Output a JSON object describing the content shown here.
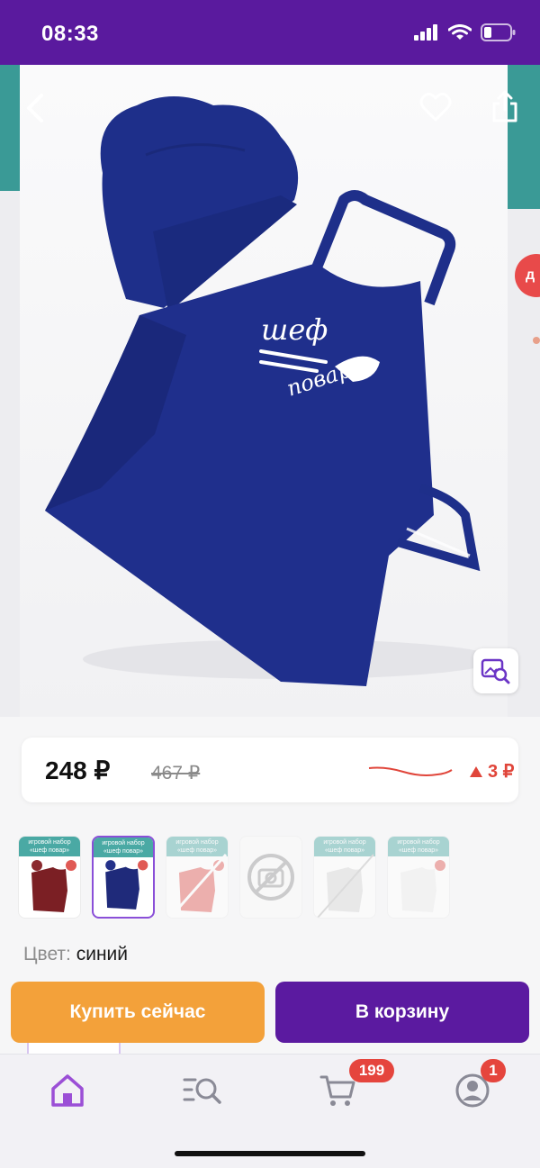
{
  "status_bar": {
    "time": "08:33"
  },
  "hero": {
    "back_icon": "chevron-left-icon",
    "favorite_icon": "heart-icon",
    "share_icon": "share-icon",
    "image_search_icon": "image-search-icon",
    "apron_logo_line1": "шеф",
    "apron_logo_line2": "повар",
    "peek_badge": "д"
  },
  "price": {
    "current": "248 ₽",
    "old": "467 ₽",
    "delta": "3 ₽",
    "delta_direction": "up",
    "trend_color": "#e0453a"
  },
  "thumbnails": [
    {
      "title": "игровой набор «шеф повар»",
      "apron_color": "#7b1f24",
      "selected": false,
      "faded": false
    },
    {
      "title": "игровой набор «шеф повар»",
      "apron_color": "#1f2a7a",
      "selected": true,
      "faded": false
    },
    {
      "title": "игровой набор «шеф повар»",
      "apron_color": "#e05a55",
      "selected": false,
      "faded": true
    },
    {
      "title": "",
      "apron_color": "",
      "selected": false,
      "faded": true,
      "no_image": true
    },
    {
      "title": "игровой набор «шеф повар»",
      "apron_color": "#f0f0f0",
      "selected": false,
      "faded": true
    },
    {
      "title": "игровой набор «шеф повар»",
      "apron_color": "#f8f8f8",
      "selected": false,
      "faded": true
    }
  ],
  "color": {
    "label": "Цвет:",
    "value": "синий"
  },
  "actions": {
    "buy_now": "Купить сейчас",
    "add_to_cart": "В корзину"
  },
  "nav": {
    "items": [
      {
        "icon": "home-icon"
      },
      {
        "icon": "catalog-search-icon"
      },
      {
        "icon": "cart-icon",
        "badge": "199"
      },
      {
        "icon": "profile-icon",
        "badge": "1"
      }
    ]
  },
  "colors": {
    "brand": "#5a1a9e",
    "accent": "#f3a13a",
    "badge": "#e5453d"
  }
}
